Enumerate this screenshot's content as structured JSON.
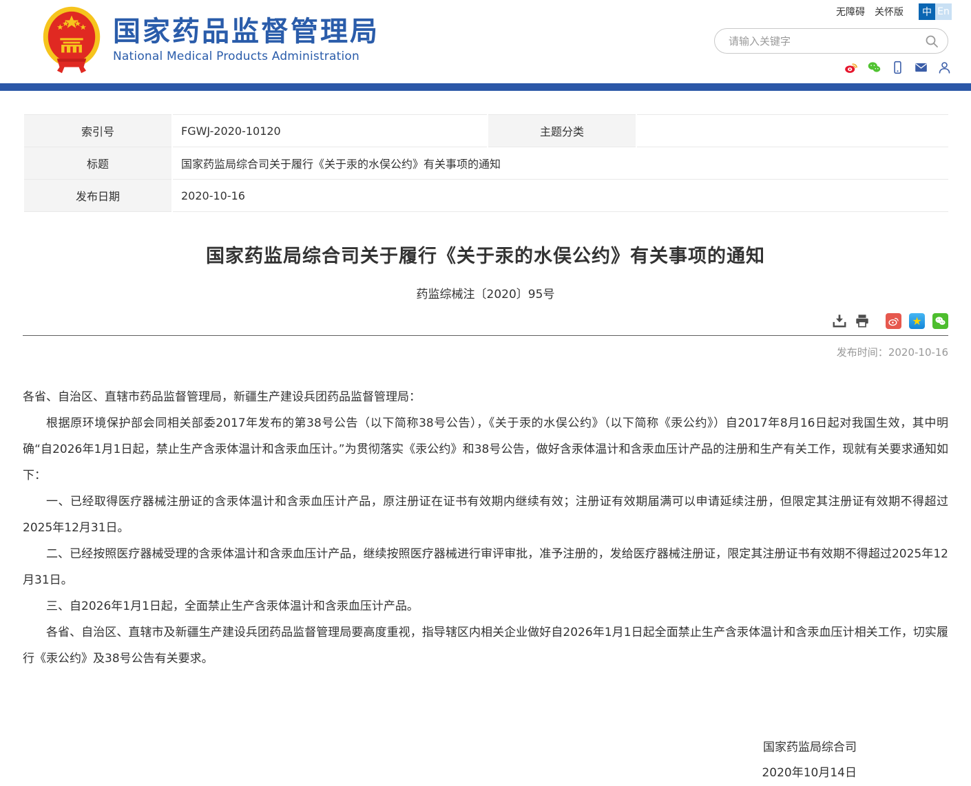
{
  "header": {
    "site_title": "国家药品监督管理局",
    "site_subtitle": "National Medical Products Administration",
    "links": {
      "accessibility": "无障碍",
      "care": "关怀版"
    },
    "lang": {
      "zh": "中",
      "en": "En"
    },
    "search": {
      "placeholder": "请输入关键字"
    }
  },
  "icons": {
    "top": [
      "weibo-icon",
      "wechat-icon",
      "mobile-icon",
      "mail-icon",
      "user-icon"
    ],
    "search": "search-icon",
    "actions": [
      "download-icon",
      "print-icon",
      "weibo-share-icon",
      "qzone-share-icon",
      "wechat-share-icon"
    ]
  },
  "colors": {
    "brand_blue": "#2a5caa",
    "bar_blue": "#2b57a7",
    "lang_active_bg": "#0b66b3",
    "lang_inactive_bg": "#c9e0f4",
    "table_label_bg": "#f4f4f4",
    "weibo_red": "#e6584e",
    "qzone_blue": "#1586d8",
    "wechat_green": "#4dbe2e",
    "muted_gray": "#999999"
  },
  "meta_table": {
    "index_label": "索引号",
    "index_value": "FGWJ-2020-10120",
    "category_label": "主题分类",
    "category_value": "",
    "title_label": "标题",
    "title_value": "国家药监局综合司关于履行《关于汞的水俣公约》有关事项的通知",
    "date_label": "发布日期",
    "date_value": "2020-10-16"
  },
  "document": {
    "title": "国家药监局综合司关于履行《关于汞的水俣公约》有关事项的通知",
    "doc_number": "药监综械注〔2020〕95号",
    "publish_time_label": "发布时间：",
    "publish_time": "2020-10-16",
    "qzone_star": "★",
    "paragraphs": [
      {
        "indent": false,
        "text": "各省、自治区、直辖市药品监督管理局，新疆生产建设兵团药品监督管理局："
      },
      {
        "indent": true,
        "text": "根据原环境保护部会同相关部委2017年发布的第38号公告（以下简称38号公告），《关于汞的水俣公约》（以下简称《汞公约》）自2017年8月16日起对我国生效，其中明确“自2026年1月1日起，禁止生产含汞体温计和含汞血压计。”为贯彻落实《汞公约》和38号公告，做好含汞体温计和含汞血压计产品的注册和生产有关工作，现就有关要求通知如下："
      },
      {
        "indent": true,
        "text": "一、已经取得医疗器械注册证的含汞体温计和含汞血压计产品，原注册证在证书有效期内继续有效；注册证有效期届满可以申请延续注册，但限定其注册证有效期不得超过2025年12月31日。"
      },
      {
        "indent": true,
        "text": "二、已经按照医疗器械受理的含汞体温计和含汞血压计产品，继续按照医疗器械进行审评审批，准予注册的，发给医疗器械注册证，限定其注册证书有效期不得超过2025年12月31日。"
      },
      {
        "indent": true,
        "text": "三、自2026年1月1日起，全面禁止生产含汞体温计和含汞血压计产品。"
      },
      {
        "indent": true,
        "text": "各省、自治区、直辖市及新疆生产建设兵团药品监督管理局要高度重视，指导辖区内相关企业做好自2026年1月1日起全面禁止生产含汞体温计和含汞血压计相关工作，切实履行《汞公约》及38号公告有关要求。"
      }
    ],
    "signature": {
      "org": "国家药监局综合司",
      "date": "2020年10月14日"
    }
  }
}
